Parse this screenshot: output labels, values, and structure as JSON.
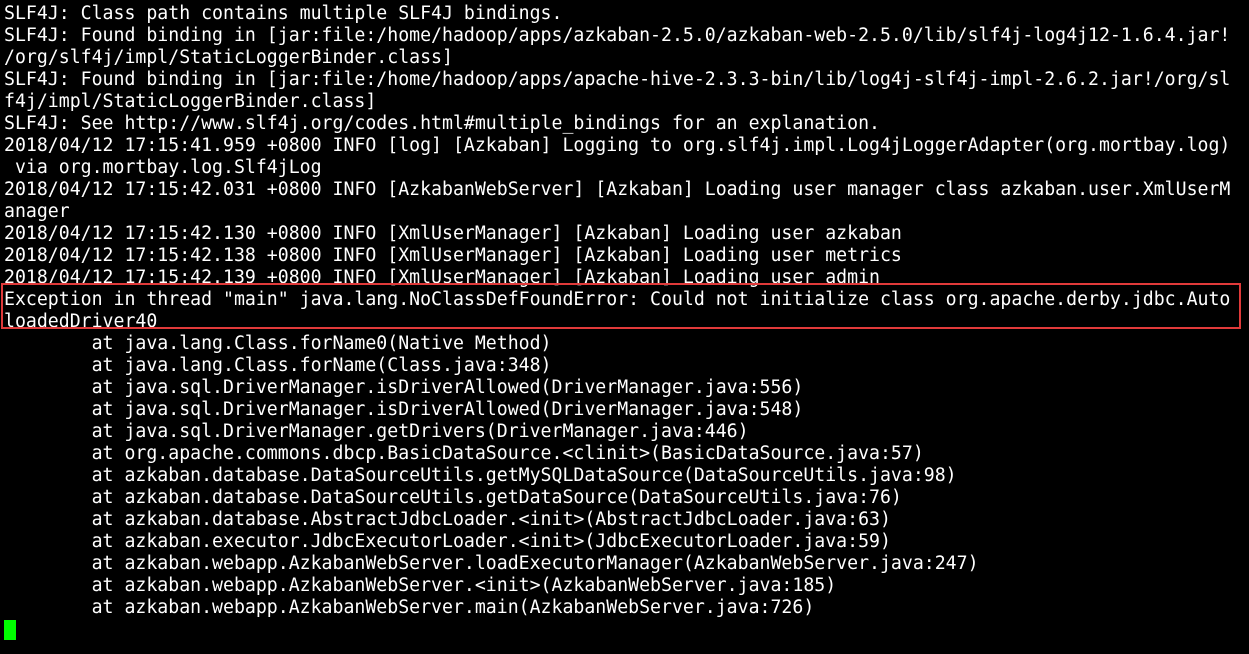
{
  "terminal": {
    "colors": {
      "background": "#000000",
      "foreground": "#ffffff",
      "highlight_border": "#e03a3a",
      "cursor": "#00ff00"
    },
    "lines": [
      "SLF4J: Class path contains multiple SLF4J bindings.",
      "SLF4J: Found binding in [jar:file:/home/hadoop/apps/azkaban-2.5.0/azkaban-web-2.5.0/lib/slf4j-log4j12-1.6.4.jar!",
      "/org/slf4j/impl/StaticLoggerBinder.class]",
      "SLF4J: Found binding in [jar:file:/home/hadoop/apps/apache-hive-2.3.3-bin/lib/log4j-slf4j-impl-2.6.2.jar!/org/sl",
      "f4j/impl/StaticLoggerBinder.class]",
      "SLF4J: See http://www.slf4j.org/codes.html#multiple_bindings for an explanation.",
      "2018/04/12 17:15:41.959 +0800 INFO [log] [Azkaban] Logging to org.slf4j.impl.Log4jLoggerAdapter(org.mortbay.log)",
      " via org.mortbay.log.Slf4jLog",
      "2018/04/12 17:15:42.031 +0800 INFO [AzkabanWebServer] [Azkaban] Loading user manager class azkaban.user.XmlUserM",
      "anager",
      "2018/04/12 17:15:42.130 +0800 INFO [XmlUserManager] [Azkaban] Loading user azkaban",
      "2018/04/12 17:15:42.138 +0800 INFO [XmlUserManager] [Azkaban] Loading user metrics",
      "2018/04/12 17:15:42.139 +0800 INFO [XmlUserManager] [Azkaban] Loading user admin",
      "Exception in thread \"main\" java.lang.NoClassDefFoundError: Could not initialize class org.apache.derby.jdbc.Auto",
      "loadedDriver40",
      "        at java.lang.Class.forName0(Native Method)",
      "        at java.lang.Class.forName(Class.java:348)",
      "        at java.sql.DriverManager.isDriverAllowed(DriverManager.java:556)",
      "        at java.sql.DriverManager.isDriverAllowed(DriverManager.java:548)",
      "        at java.sql.DriverManager.getDrivers(DriverManager.java:446)",
      "        at org.apache.commons.dbcp.BasicDataSource.<clinit>(BasicDataSource.java:57)",
      "        at azkaban.database.DataSourceUtils.getMySQLDataSource(DataSourceUtils.java:98)",
      "        at azkaban.database.DataSourceUtils.getDataSource(DataSourceUtils.java:76)",
      "        at azkaban.database.AbstractJdbcLoader.<init>(AbstractJdbcLoader.java:63)",
      "        at azkaban.executor.JdbcExecutorLoader.<init>(JdbcExecutorLoader.java:59)",
      "        at azkaban.webapp.AzkabanWebServer.loadExecutorManager(AzkabanWebServer.java:247)",
      "        at azkaban.webapp.AzkabanWebServer.<init>(AzkabanWebServer.java:185)",
      "        at azkaban.webapp.AzkabanWebServer.main(AzkabanWebServer.java:726)"
    ]
  }
}
